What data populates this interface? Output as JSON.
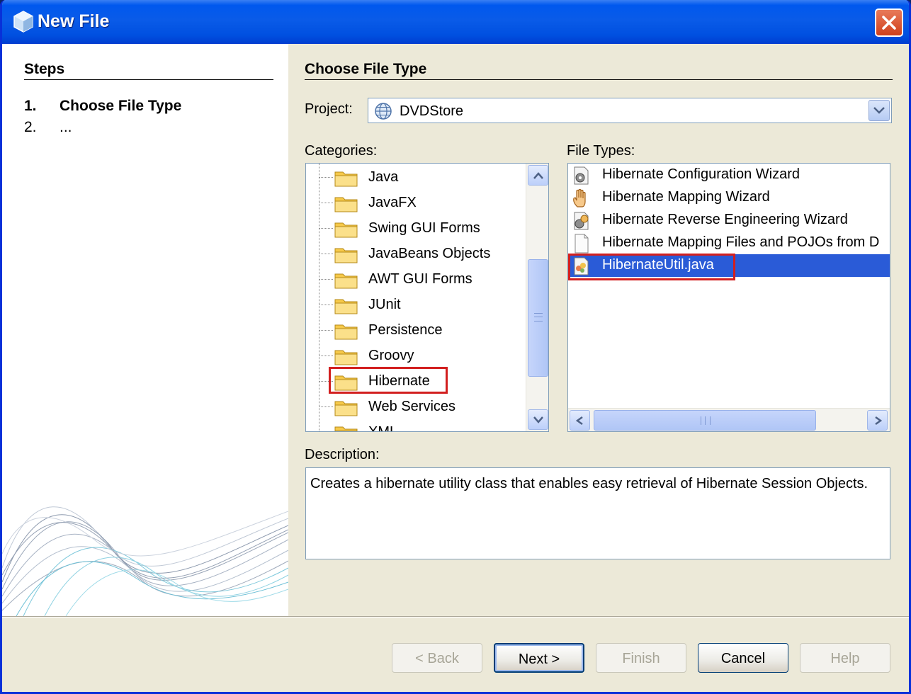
{
  "window": {
    "title": "New File"
  },
  "steps": {
    "title": "Steps",
    "items": [
      {
        "num": "1.",
        "label": "Choose File Type"
      },
      {
        "num": "2.",
        "label": "..."
      }
    ]
  },
  "panel": {
    "title": "Choose File Type"
  },
  "project": {
    "label": "Project:",
    "value": "DVDStore"
  },
  "categories": {
    "label": "Categories:",
    "items": [
      "Java",
      "JavaFX",
      "Swing GUI Forms",
      "JavaBeans Objects",
      "AWT GUI Forms",
      "JUnit",
      "Persistence",
      "Groovy",
      "Hibernate",
      "Web Services",
      "XML"
    ],
    "highlighted": "Hibernate"
  },
  "file_types": {
    "label": "File Types:",
    "items": [
      {
        "label": "Hibernate Configuration Wizard",
        "icon": "config-wizard-icon"
      },
      {
        "label": "Hibernate Mapping Wizard",
        "icon": "hand-icon"
      },
      {
        "label": "Hibernate Reverse Engineering Wizard",
        "icon": "reverse-engineering-icon"
      },
      {
        "label": "Hibernate Mapping Files and POJOs from D",
        "icon": "blank-file-icon"
      },
      {
        "label": "HibernateUtil.java",
        "icon": "java-class-icon"
      }
    ],
    "selected": "HibernateUtil.java"
  },
  "description": {
    "label": "Description:",
    "text": "Creates a hibernate utility class that enables easy retrieval of Hibernate Session Objects."
  },
  "buttons": {
    "back": "< Back",
    "next": "Next >",
    "finish": "Finish",
    "cancel": "Cancel",
    "help": "Help"
  },
  "colors": {
    "title_bar": "#0058ee",
    "selection": "#2a5bd7",
    "highlight_border": "#d21f1f",
    "dialog_bg": "#ece9d8"
  }
}
